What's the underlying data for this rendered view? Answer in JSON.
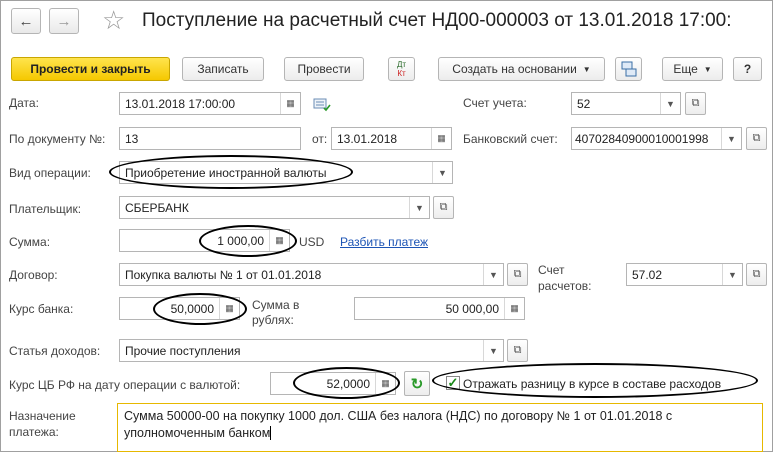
{
  "toolbar": {
    "back": "←",
    "forward": "→",
    "star": "☆",
    "title": "Поступление на расчетный счет НД00-000003 от 13.01.2018 17:00:",
    "post_close": "Провести и закрыть",
    "save": "Записать",
    "post": "Провести",
    "dtkt_top": "Дт",
    "dtkt_bottom": "Кт",
    "create_based": "Создать на основании",
    "more": "Еще",
    "help": "?"
  },
  "form": {
    "date_label": "Дата:",
    "date_value": "13.01.2018 17:00:00",
    "account_label": "Счет учета:",
    "account_value": "52",
    "doc_num_label": "По документу №:",
    "doc_num_value": "13",
    "from_label": "от:",
    "from_value": "13.01.2018",
    "bank_account_label": "Банковский счет:",
    "bank_account_value": "40702840900010001998",
    "op_type_label": "Вид операции:",
    "op_type_value": "Приобретение иностранной валюты",
    "payer_label": "Плательщик:",
    "payer_value": "СБЕРБАНК",
    "sum_label": "Сумма:",
    "sum_value": "1 000,00",
    "currency": "USD",
    "split_link": "Разбить платеж",
    "contract_label": "Договор:",
    "contract_value": "Покупка валюты № 1 от 01.01.2018",
    "settlement_label_1": "Счет",
    "settlement_label_2": "расчетов:",
    "settlement_value": "57.02",
    "bank_rate_label": "Курс банка:",
    "bank_rate_value": "50,0000",
    "sum_rub_label_1": "Сумма в",
    "sum_rub_label_2": "рублях:",
    "sum_rub_value": "50 000,00",
    "income_label": "Статья доходов:",
    "income_value": "Прочие поступления",
    "cb_rate_label": "Курс ЦБ РФ на дату операции с валютой:",
    "cb_rate_value": "52,0000",
    "reflect_diff_label": "Отражать разницу в курсе в составе расходов",
    "reflect_diff_checked": true,
    "purpose_label_1": "Назначение",
    "purpose_label_2": "платежа:",
    "purpose_value": "Сумма 50000-00 на покупку 1000 дол. США без налога (НДС) по договору № 1 от 01.01.2018 с уполномоченным банком"
  }
}
